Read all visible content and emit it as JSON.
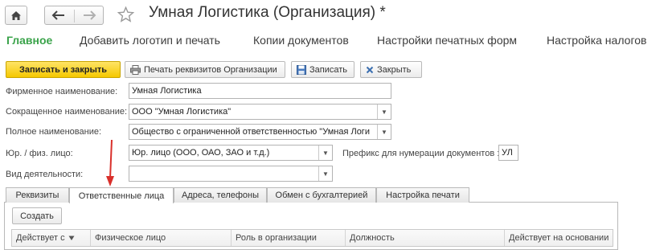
{
  "title": "Умная Логистика (Организация) *",
  "sections": {
    "main": "Главное",
    "add_logo": "Добавить логотип и печать",
    "doc_copies": "Копии документов",
    "print_settings": "Настройки печатных форм",
    "tax_settings": "Настройка налогов"
  },
  "toolbar": {
    "save_close": "Записать и закрыть",
    "print_details": "Печать реквизитов Организации",
    "save": "Записать",
    "close": "Закрыть"
  },
  "form": {
    "firm_name_label": "Фирменное наименование:",
    "firm_name_value": "Умная Логистика",
    "short_name_label": "Сокращенное наименование:",
    "short_name_value": "ООО \"Умная Логистика\"",
    "full_name_label": "Полное наименование:",
    "full_name_value": "Общество с ограниченной ответственностью \"Умная Логи",
    "entity_type_label": "Юр. / физ. лицо:",
    "entity_type_value": "Юр. лицо (ООО, ОАО, ЗАО и т.д.)",
    "prefix_label": "Префикс для нумерации документов :",
    "prefix_value": "УЛ",
    "activity_label": "Вид деятельности:",
    "activity_value": ""
  },
  "tabs": [
    {
      "label": "Реквизиты",
      "active": false
    },
    {
      "label": "Ответственные лица",
      "active": true
    },
    {
      "label": "Адреса, телефоны",
      "active": false
    },
    {
      "label": "Обмен с бухгалтерией",
      "active": false
    },
    {
      "label": "Настройка печати",
      "active": false
    }
  ],
  "panel": {
    "create_button": "Создать",
    "columns": [
      "Действует с",
      "Физическое лицо",
      "Роль в организации",
      "Должность",
      "Действует на основании"
    ]
  },
  "colors": {
    "accent_green": "#3aa34a",
    "primary_button": "#f5c800",
    "annotation_arrow": "#d9302b"
  },
  "icons": {
    "home": "home-icon",
    "back": "arrow-left-icon",
    "forward": "arrow-right-icon",
    "favorite": "star-icon",
    "print": "printer-icon",
    "save": "floppy-icon",
    "close": "close-icon",
    "sort": "sort-down-icon"
  }
}
